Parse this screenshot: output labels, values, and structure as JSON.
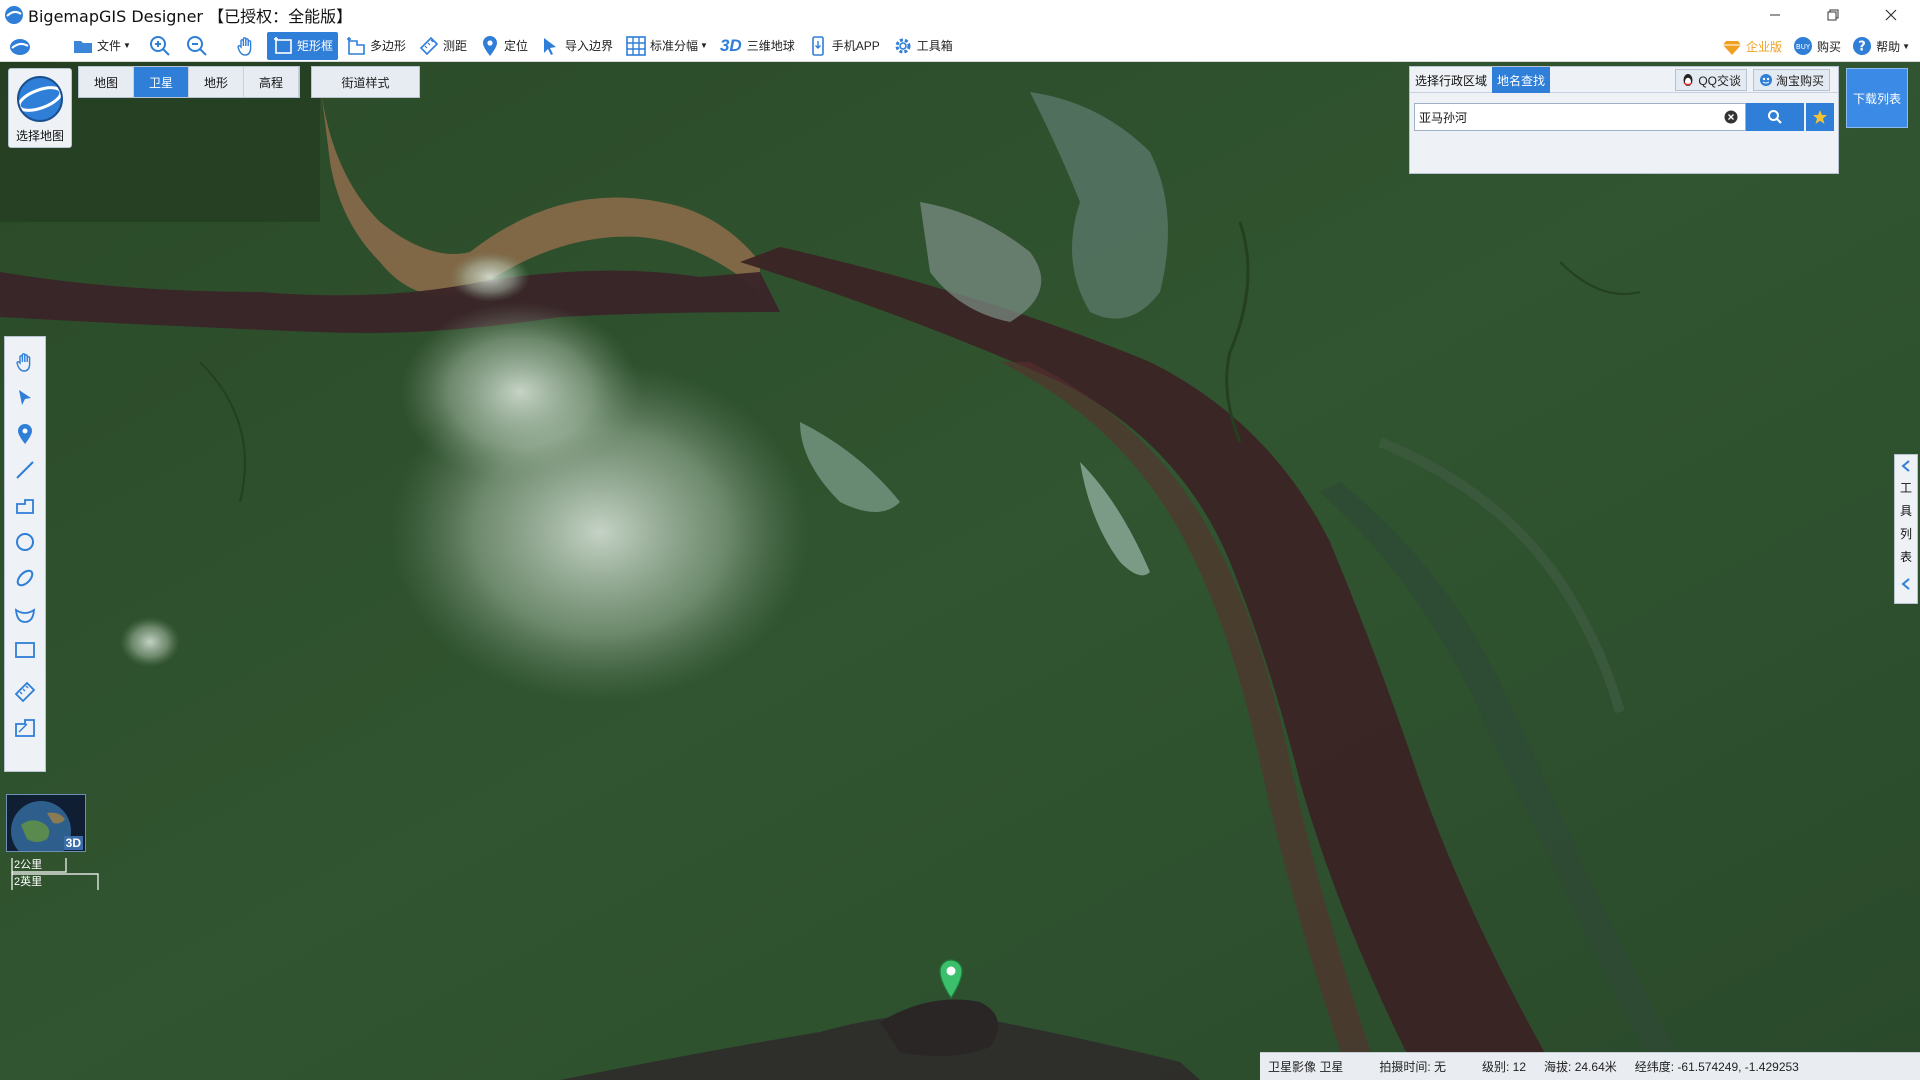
{
  "window": {
    "title": "BigemapGIS Designer 【已授权：全能版】",
    "controls": [
      "minimize",
      "restore",
      "close"
    ]
  },
  "toolbar": {
    "file": "文件",
    "zoom_in": "",
    "zoom_out": "",
    "pan": "",
    "rect_box": "矩形框",
    "polygon": "多边形",
    "measure": "测距",
    "locate": "定位",
    "import_boundary": "导入边界",
    "standard_sheet": "标准分幅",
    "globe_3d_icon": "3D",
    "globe_3d": "三维地球",
    "mobile_app": "手机APP",
    "toolbox": "工具箱",
    "enterprise": "企业版",
    "buy": "购买",
    "help": "帮助"
  },
  "map_selector": {
    "label": "选择地图"
  },
  "map_tabs": [
    {
      "label": "地图",
      "active": false
    },
    {
      "label": "卫星",
      "active": true
    },
    {
      "label": "地形",
      "active": false
    },
    {
      "label": "高程",
      "active": false
    }
  ],
  "street_style": "街道样式",
  "search_panel": {
    "tab_region": "选择行政区域",
    "tab_place": "地名查找",
    "qq": "QQ交谈",
    "taobao": "淘宝购买",
    "query": "亚马孙河"
  },
  "download_list": "下载列表",
  "tool_list": {
    "chars": [
      "工",
      "具",
      "列",
      "表"
    ]
  },
  "globe_thumb": {
    "badge": "3D"
  },
  "scale": {
    "metric": "2公里",
    "imperial": "2英里"
  },
  "status": {
    "source": "卫星影像 卫星",
    "capture_time": "拍摄时间: 无",
    "level": "级别:  12",
    "altitude": "海拔: 24.64米",
    "coords": "经纬度:   -61.574249, -1.429253"
  },
  "colors": {
    "accent": "#2f7ed8",
    "forest": "#2e4d2b",
    "river": "#3a2424",
    "sediment": "#8a6a4a",
    "marker": "#3cbf6a"
  }
}
